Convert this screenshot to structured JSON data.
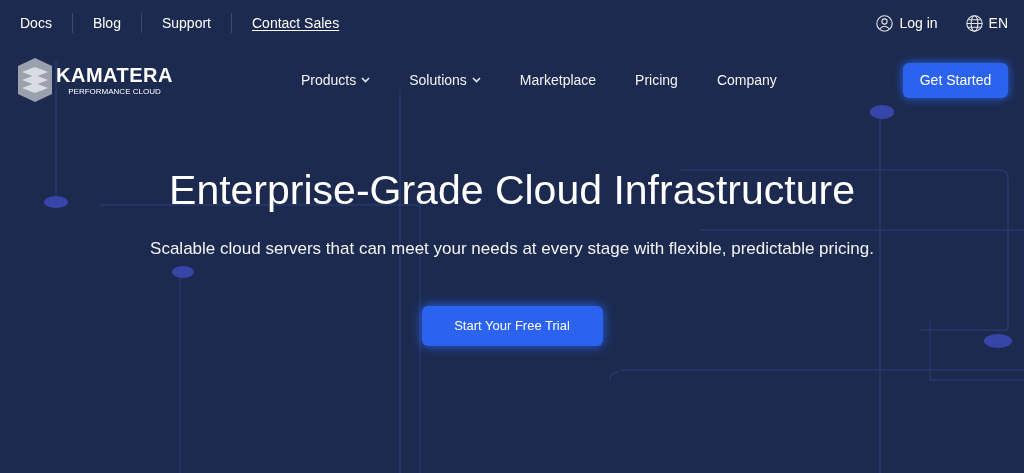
{
  "top_links": [
    {
      "label": "Docs",
      "underlined": false
    },
    {
      "label": "Blog",
      "underlined": false
    },
    {
      "label": "Support",
      "underlined": false
    },
    {
      "label": "Contact Sales",
      "underlined": true
    }
  ],
  "account": {
    "login": "Log in",
    "language": "EN"
  },
  "logo": {
    "name": "KAMATERA",
    "tagline": "PERFORMANCE CLOUD"
  },
  "nav": [
    {
      "label": "Products",
      "has_menu": true
    },
    {
      "label": "Solutions",
      "has_menu": true
    },
    {
      "label": "Marketplace",
      "has_menu": false
    },
    {
      "label": "Pricing",
      "has_menu": false
    },
    {
      "label": "Company",
      "has_menu": false
    }
  ],
  "cta": "Get Started",
  "hero": {
    "title": "Enterprise-Grade Cloud Infrastructure",
    "subtitle": "Scalable cloud servers that can meet your needs at every stage with flexible, predictable pricing.",
    "button": "Start Your Free Trial"
  }
}
